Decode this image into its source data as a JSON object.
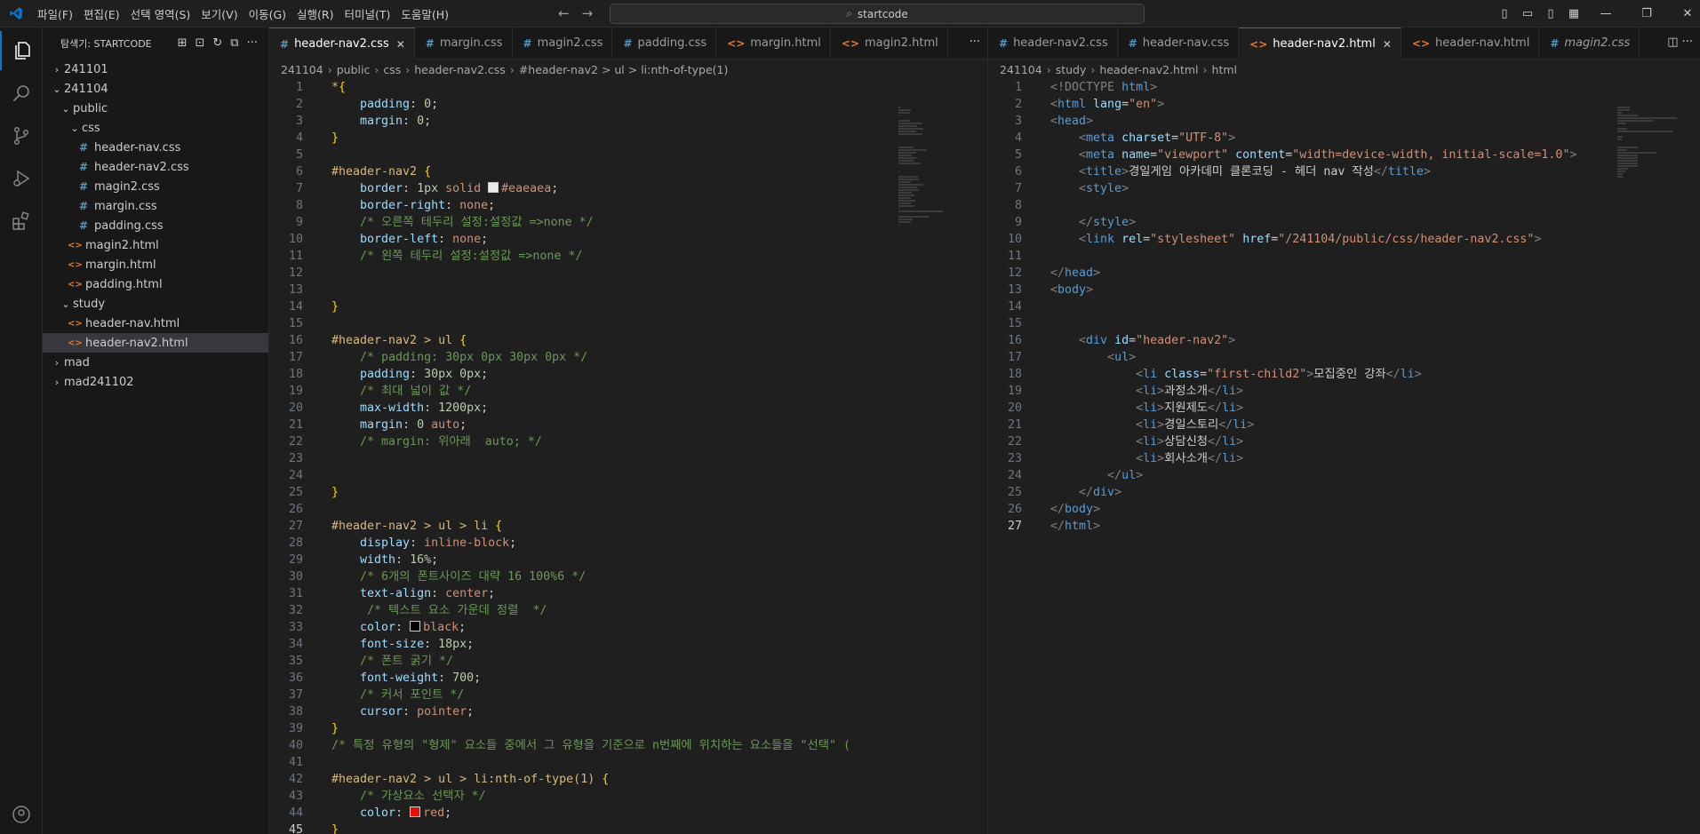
{
  "titlebar": {
    "menu": [
      "파일(F)",
      "편집(E)",
      "선택 영역(S)",
      "보기(V)",
      "이동(G)",
      "실행(R)",
      "터미널(T)",
      "도움말(H)"
    ],
    "search_text": "startcode"
  },
  "sidebar": {
    "title": "탐색기: STARTCODE",
    "tree": [
      {
        "label": "241101",
        "type": "folder",
        "depth": 0,
        "open": false
      },
      {
        "label": "241104",
        "type": "folder",
        "depth": 0,
        "open": true
      },
      {
        "label": "public",
        "type": "folder",
        "depth": 1,
        "open": true
      },
      {
        "label": "css",
        "type": "folder",
        "depth": 2,
        "open": true
      },
      {
        "label": "header-nav.css",
        "type": "css",
        "depth": 3
      },
      {
        "label": "header-nav2.css",
        "type": "css",
        "depth": 3
      },
      {
        "label": "magin2.css",
        "type": "css",
        "depth": 3
      },
      {
        "label": "margin.css",
        "type": "css",
        "depth": 3
      },
      {
        "label": "padding.css",
        "type": "css",
        "depth": 3
      },
      {
        "label": "magin2.html",
        "type": "html",
        "depth": 2
      },
      {
        "label": "margin.html",
        "type": "html",
        "depth": 2
      },
      {
        "label": "padding.html",
        "type": "html",
        "depth": 2
      },
      {
        "label": "study",
        "type": "folder",
        "depth": 1,
        "open": true
      },
      {
        "label": "header-nav.html",
        "type": "html",
        "depth": 2
      },
      {
        "label": "header-nav2.html",
        "type": "html",
        "depth": 2,
        "selected": true
      },
      {
        "label": "mad",
        "type": "folder",
        "depth": 0,
        "open": false
      },
      {
        "label": "mad241102",
        "type": "folder",
        "depth": 0,
        "open": false
      }
    ]
  },
  "left_editor": {
    "tabs": [
      {
        "label": "header-nav2.css",
        "type": "css",
        "active": true
      },
      {
        "label": "margin.css",
        "type": "css"
      },
      {
        "label": "magin2.css",
        "type": "css"
      },
      {
        "label": "padding.css",
        "type": "css"
      },
      {
        "label": "margin.html",
        "type": "html"
      },
      {
        "label": "magin2.html",
        "type": "html"
      }
    ],
    "breadcrumbs": [
      "241104",
      "public",
      "css",
      "header-nav2.css",
      "#header-nav2 > ul > li:nth-of-type(1)"
    ],
    "current_line": 45,
    "lines": [
      [
        [
          "*",
          "c-sel"
        ],
        [
          "{",
          "c-brace"
        ]
      ],
      [
        [
          "    padding",
          "c-prop"
        ],
        [
          ": ",
          "c-punc"
        ],
        [
          "0",
          "c-num"
        ],
        [
          ";",
          "c-punc"
        ]
      ],
      [
        [
          "    margin",
          "c-prop"
        ],
        [
          ": ",
          "c-punc"
        ],
        [
          "0",
          "c-num"
        ],
        [
          ";",
          "c-punc"
        ]
      ],
      [
        [
          "}",
          "c-brace"
        ]
      ],
      [],
      [
        [
          "#header-nav2 ",
          "c-sel"
        ],
        [
          "{",
          "c-brace"
        ]
      ],
      [
        [
          "    border",
          "c-prop"
        ],
        [
          ": ",
          "c-punc"
        ],
        [
          "1px",
          "c-num"
        ],
        [
          " solid ",
          "c-val"
        ],
        [
          "#eaeaea",
          "c-val",
          "#eaeaea"
        ],
        [
          ";",
          "c-punc"
        ]
      ],
      [
        [
          "    border-right",
          "c-prop"
        ],
        [
          ": ",
          "c-punc"
        ],
        [
          "none",
          "c-val"
        ],
        [
          ";",
          "c-punc"
        ]
      ],
      [
        [
          "    /* 오른쪽 테두리 설정:설정값 =>none */",
          "c-com"
        ]
      ],
      [
        [
          "    border-left",
          "c-prop"
        ],
        [
          ": ",
          "c-punc"
        ],
        [
          "none",
          "c-val"
        ],
        [
          ";",
          "c-punc"
        ]
      ],
      [
        [
          "    /* 왼쪽 테두리 설정:설정값 =>none */",
          "c-com"
        ]
      ],
      [],
      [],
      [
        [
          "}",
          "c-brace"
        ]
      ],
      [],
      [
        [
          "#header-nav2 > ul ",
          "c-sel"
        ],
        [
          "{",
          "c-brace"
        ]
      ],
      [
        [
          "    /* padding: 30px 0px 30px 0px */",
          "c-com"
        ]
      ],
      [
        [
          "    padding",
          "c-prop"
        ],
        [
          ": ",
          "c-punc"
        ],
        [
          "30px 0px",
          "c-num"
        ],
        [
          ";",
          "c-punc"
        ]
      ],
      [
        [
          "    /* 최대 넓이 값 */",
          "c-com"
        ]
      ],
      [
        [
          "    max-width",
          "c-prop"
        ],
        [
          ": ",
          "c-punc"
        ],
        [
          "1200px",
          "c-num"
        ],
        [
          ";",
          "c-punc"
        ]
      ],
      [
        [
          "    margin",
          "c-prop"
        ],
        [
          ": ",
          "c-punc"
        ],
        [
          "0",
          "c-num"
        ],
        [
          " auto",
          "c-val"
        ],
        [
          ";",
          "c-punc"
        ]
      ],
      [
        [
          "    /* margin: 위아래  auto; */",
          "c-com"
        ]
      ],
      [],
      [],
      [
        [
          "}",
          "c-brace"
        ]
      ],
      [],
      [
        [
          "#header-nav2 > ul > li ",
          "c-sel"
        ],
        [
          "{",
          "c-brace"
        ]
      ],
      [
        [
          "    display",
          "c-prop"
        ],
        [
          ": ",
          "c-punc"
        ],
        [
          "inline-block",
          "c-val"
        ],
        [
          ";",
          "c-punc"
        ]
      ],
      [
        [
          "    width",
          "c-prop"
        ],
        [
          ": ",
          "c-punc"
        ],
        [
          "16%",
          "c-num"
        ],
        [
          ";",
          "c-punc"
        ]
      ],
      [
        [
          "    /* 6개의 폰트사이즈 대략 16 100%6 */",
          "c-com"
        ]
      ],
      [
        [
          "    text-align",
          "c-prop"
        ],
        [
          ": ",
          "c-punc"
        ],
        [
          "center",
          "c-val"
        ],
        [
          ";",
          "c-punc"
        ]
      ],
      [
        [
          "     /* 텍스트 요소 가운데 정렬  */",
          "c-com"
        ]
      ],
      [
        [
          "    color",
          "c-prop"
        ],
        [
          ": ",
          "c-punc"
        ],
        [
          "black",
          "c-val",
          "#000000"
        ],
        [
          ";",
          "c-punc"
        ]
      ],
      [
        [
          "    font-size",
          "c-prop"
        ],
        [
          ": ",
          "c-punc"
        ],
        [
          "18px",
          "c-num"
        ],
        [
          ";",
          "c-punc"
        ]
      ],
      [
        [
          "    /* 폰트 굵기 */",
          "c-com"
        ]
      ],
      [
        [
          "    font-weight",
          "c-prop"
        ],
        [
          ": ",
          "c-punc"
        ],
        [
          "700",
          "c-num"
        ],
        [
          ";",
          "c-punc"
        ]
      ],
      [
        [
          "    /* 커서 포인트 */",
          "c-com"
        ]
      ],
      [
        [
          "    cursor",
          "c-prop"
        ],
        [
          ": ",
          "c-punc"
        ],
        [
          "pointer",
          "c-val"
        ],
        [
          ";",
          "c-punc"
        ]
      ],
      [
        [
          "}",
          "c-brace"
        ]
      ],
      [
        [
          "/* 특정 유형의 \"형제\" 요소들 중에서 그 유형을 기준으로 n번째에 위치하는 요소들을 \"선택\" (",
          "c-com"
        ]
      ],
      [],
      [
        [
          "#header-nav2 > ul > li:nth-of-type(1) ",
          "c-sel"
        ],
        [
          "{",
          "c-brace"
        ]
      ],
      [
        [
          "    /* 가상요소 선택자 */",
          "c-com"
        ]
      ],
      [
        [
          "    color",
          "c-prop"
        ],
        [
          ": ",
          "c-punc"
        ],
        [
          "red",
          "c-val",
          "#e51400"
        ],
        [
          ";",
          "c-punc"
        ]
      ],
      [
        [
          "}",
          "c-brace"
        ]
      ]
    ]
  },
  "right_editor": {
    "tabs": [
      {
        "label": "header-nav2.css",
        "type": "css"
      },
      {
        "label": "header-nav.css",
        "type": "css"
      },
      {
        "label": "header-nav2.html",
        "type": "html",
        "active": true
      },
      {
        "label": "header-nav.html",
        "type": "html"
      },
      {
        "label": "magin2.css",
        "type": "css",
        "italic": true
      }
    ],
    "breadcrumbs": [
      "241104",
      "study",
      "header-nav2.html",
      "html"
    ],
    "current_line": 27,
    "lines": [
      [
        [
          "<!DOCTYPE ",
          "c-gray"
        ],
        [
          "html",
          "c-tag"
        ],
        [
          ">",
          "c-gray"
        ]
      ],
      [
        [
          "<",
          "c-gray"
        ],
        [
          "html ",
          "c-tag"
        ],
        [
          "lang",
          "c-attr"
        ],
        [
          "=",
          "c-punc"
        ],
        [
          "\"en\"",
          "c-str"
        ],
        [
          ">",
          "c-gray"
        ]
      ],
      [
        [
          "<",
          "c-gray"
        ],
        [
          "head",
          "c-tag"
        ],
        [
          ">",
          "c-gray"
        ]
      ],
      [
        [
          "    <",
          "c-gray"
        ],
        [
          "meta ",
          "c-tag"
        ],
        [
          "charset",
          "c-attr"
        ],
        [
          "=",
          "c-punc"
        ],
        [
          "\"UTF-8\"",
          "c-str"
        ],
        [
          ">",
          "c-gray"
        ]
      ],
      [
        [
          "    <",
          "c-gray"
        ],
        [
          "meta ",
          "c-tag"
        ],
        [
          "name",
          "c-attr"
        ],
        [
          "=",
          "c-punc"
        ],
        [
          "\"viewport\" ",
          "c-str"
        ],
        [
          "content",
          "c-attr"
        ],
        [
          "=",
          "c-punc"
        ],
        [
          "\"width=device-width, initial-scale=1.0\"",
          "c-str"
        ],
        [
          ">",
          "c-gray"
        ]
      ],
      [
        [
          "    <",
          "c-gray"
        ],
        [
          "title",
          "c-tag"
        ],
        [
          ">",
          "c-gray"
        ],
        [
          "경일게임 아카데미 클론코딩 - 헤더 nav 작성",
          "c-txt"
        ],
        [
          "</",
          "c-gray"
        ],
        [
          "title",
          "c-tag"
        ],
        [
          ">",
          "c-gray"
        ]
      ],
      [
        [
          "    <",
          "c-gray"
        ],
        [
          "style",
          "c-tag"
        ],
        [
          ">",
          "c-gray"
        ]
      ],
      [],
      [
        [
          "    </",
          "c-gray"
        ],
        [
          "style",
          "c-tag"
        ],
        [
          ">",
          "c-gray"
        ]
      ],
      [
        [
          "    <",
          "c-gray"
        ],
        [
          "link ",
          "c-tag"
        ],
        [
          "rel",
          "c-attr"
        ],
        [
          "=",
          "c-punc"
        ],
        [
          "\"stylesheet\" ",
          "c-str"
        ],
        [
          "href",
          "c-attr"
        ],
        [
          "=",
          "c-punc"
        ],
        [
          "\"/241104/public/css/header-nav2.css\"",
          "c-str"
        ],
        [
          ">",
          "c-gray"
        ]
      ],
      [],
      [
        [
          "</",
          "c-gray"
        ],
        [
          "head",
          "c-tag"
        ],
        [
          ">",
          "c-gray"
        ]
      ],
      [
        [
          "<",
          "c-gray"
        ],
        [
          "body",
          "c-tag"
        ],
        [
          ">",
          "c-gray"
        ]
      ],
      [],
      [],
      [
        [
          "    <",
          "c-gray"
        ],
        [
          "div ",
          "c-tag"
        ],
        [
          "id",
          "c-attr"
        ],
        [
          "=",
          "c-punc"
        ],
        [
          "\"header-nav2\"",
          "c-str"
        ],
        [
          ">",
          "c-gray"
        ]
      ],
      [
        [
          "        <",
          "c-gray"
        ],
        [
          "ul",
          "c-tag"
        ],
        [
          ">",
          "c-gray"
        ]
      ],
      [
        [
          "            <",
          "c-gray"
        ],
        [
          "li ",
          "c-tag"
        ],
        [
          "class",
          "c-attr"
        ],
        [
          "=",
          "c-punc"
        ],
        [
          "\"first-child2\"",
          "c-str"
        ],
        [
          ">",
          "c-gray"
        ],
        [
          "모집중인 강좌",
          "c-txt"
        ],
        [
          "</",
          "c-gray"
        ],
        [
          "li",
          "c-tag"
        ],
        [
          ">",
          "c-gray"
        ]
      ],
      [
        [
          "            <",
          "c-gray"
        ],
        [
          "li",
          "c-tag"
        ],
        [
          ">",
          "c-gray"
        ],
        [
          "과정소개",
          "c-txt"
        ],
        [
          "</",
          "c-gray"
        ],
        [
          "li",
          "c-tag"
        ],
        [
          ">",
          "c-gray"
        ]
      ],
      [
        [
          "            <",
          "c-gray"
        ],
        [
          "li",
          "c-tag"
        ],
        [
          ">",
          "c-gray"
        ],
        [
          "지원제도",
          "c-txt"
        ],
        [
          "</",
          "c-gray"
        ],
        [
          "li",
          "c-tag"
        ],
        [
          ">",
          "c-gray"
        ]
      ],
      [
        [
          "            <",
          "c-gray"
        ],
        [
          "li",
          "c-tag"
        ],
        [
          ">",
          "c-gray"
        ],
        [
          "경일스토리",
          "c-txt"
        ],
        [
          "</",
          "c-gray"
        ],
        [
          "li",
          "c-tag"
        ],
        [
          ">",
          "c-gray"
        ]
      ],
      [
        [
          "            <",
          "c-gray"
        ],
        [
          "li",
          "c-tag"
        ],
        [
          ">",
          "c-gray"
        ],
        [
          "상담신청",
          "c-txt"
        ],
        [
          "</",
          "c-gray"
        ],
        [
          "li",
          "c-tag"
        ],
        [
          ">",
          "c-gray"
        ]
      ],
      [
        [
          "            <",
          "c-gray"
        ],
        [
          "li",
          "c-tag"
        ],
        [
          ">",
          "c-gray"
        ],
        [
          "회사소개",
          "c-txt"
        ],
        [
          "</",
          "c-gray"
        ],
        [
          "li",
          "c-tag"
        ],
        [
          ">",
          "c-gray"
        ]
      ],
      [
        [
          "        </",
          "c-gray"
        ],
        [
          "ul",
          "c-tag"
        ],
        [
          ">",
          "c-gray"
        ]
      ],
      [
        [
          "    </",
          "c-gray"
        ],
        [
          "div",
          "c-tag"
        ],
        [
          ">",
          "c-gray"
        ]
      ],
      [
        [
          "</",
          "c-gray"
        ],
        [
          "body",
          "c-tag"
        ],
        [
          ">",
          "c-gray"
        ]
      ],
      [
        [
          "</",
          "c-gray"
        ],
        [
          "html",
          "c-tag"
        ],
        [
          ">",
          "c-gray"
        ]
      ]
    ]
  },
  "colors": {
    "accent": "#0078d4",
    "css_icon": "#519aba",
    "html_icon": "#e37933"
  }
}
